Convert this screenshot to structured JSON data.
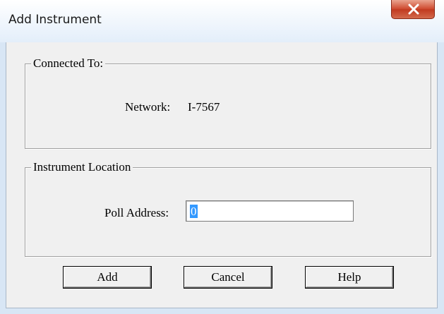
{
  "window": {
    "title": "Add Instrument"
  },
  "connected_group": {
    "legend": "Connected To:",
    "network_label": "Network:",
    "network_value": "I-7567"
  },
  "location_group": {
    "legend": "Instrument Location",
    "poll_label": "Poll Address:",
    "poll_value": "0"
  },
  "buttons": {
    "add": "Add",
    "cancel": "Cancel",
    "help": "Help"
  },
  "icons": {
    "close": "close-icon"
  },
  "colors": {
    "title_bg": "#e3eefa",
    "close_bg": "#c94a2f",
    "selection": "#3399ff",
    "dialog_bg": "#f0f0f0"
  }
}
